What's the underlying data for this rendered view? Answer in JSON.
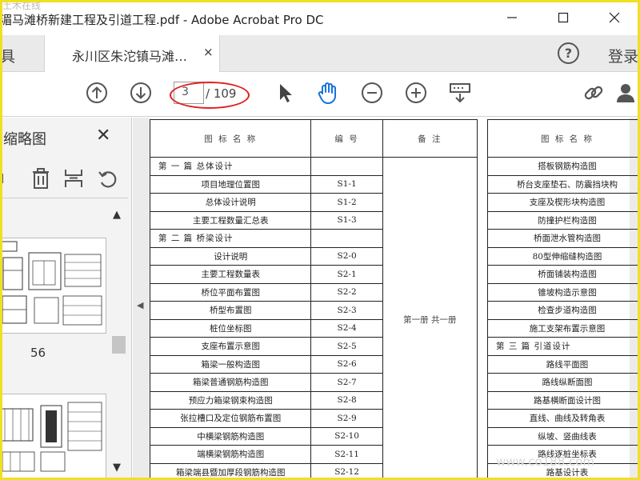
{
  "window": {
    "title": "滩桥新建工程及引道工程.pdf - Adobe Acrobat Pro DC",
    "title_prefix": "湄马",
    "watermark_top": "土木在线",
    "controls": [
      "—",
      "☐",
      "✕"
    ]
  },
  "tabs": {
    "tools_label": "具",
    "doc_label": "永川区朱沱镇马滩…",
    "close": "×",
    "help": "?",
    "login": "登录"
  },
  "toolbar": {
    "page_current": "3",
    "page_total": "/ 109"
  },
  "left_panel": {
    "title": "缩略图",
    "close": "✕",
    "thumb_page_number": "56",
    "scroll_up": "▲",
    "scroll_down": "▼"
  },
  "doc": {
    "collapse": "◀",
    "left_table": {
      "headers": [
        "图  标  名  称",
        "编    号",
        "备    注"
      ],
      "remark": "第一册  共一册",
      "rows": [
        {
          "name": "第  一  篇    总体设计",
          "code": "",
          "section": true
        },
        {
          "name": "项目地理位置图",
          "code": "S1-1"
        },
        {
          "name": "总体设计说明",
          "code": "S1-2"
        },
        {
          "name": "主要工程数量汇总表",
          "code": "S1-3"
        },
        {
          "name": "第  二  篇    桥梁设计",
          "code": "",
          "section": true
        },
        {
          "name": "设计说明",
          "code": "S2-0"
        },
        {
          "name": "主要工程数量表",
          "code": "S2-1"
        },
        {
          "name": "桥位平面布置图",
          "code": "S2-2"
        },
        {
          "name": "桥型布置图",
          "code": "S2-3"
        },
        {
          "name": "桩位坐标图",
          "code": "S2-4"
        },
        {
          "name": "支座布置示意图",
          "code": "S2-5"
        },
        {
          "name": "箱梁一般构造图",
          "code": "S2-6"
        },
        {
          "name": "箱梁普通钢筋构造图",
          "code": "S2-7"
        },
        {
          "name": "预应力箱梁钢束构造图",
          "code": "S2-8"
        },
        {
          "name": "张拉槽口及定位钢筋布置图",
          "code": "S2-9"
        },
        {
          "name": "中横梁钢筋构造图",
          "code": "S2-10"
        },
        {
          "name": "端横梁钢筋构造图",
          "code": "S2-11"
        },
        {
          "name": "箱梁端县暨加厚段钢筋构造图",
          "code": "S2-12"
        }
      ]
    },
    "right_table": {
      "header": "图  标  名  称",
      "rows": [
        "搭板钢筋构造图",
        "桥台支座垫石、防震挡块构",
        "支座及楔形块构造图",
        "防撞护栏构造图",
        "桥面泄水管构造图",
        "80型伸缩缝构造图",
        "桥面铺装构造图",
        "锥坡构造示意图",
        "检查步道构造图",
        "施工支架布置示意图",
        "第  三  篇    引道设计",
        "路线平面图",
        "路线纵断面图",
        "路基横断面设计图",
        "直线、曲线及转角表",
        "纵坡、竖曲线表",
        "路线逐桩坐标表",
        "路基设计表"
      ]
    }
  },
  "watermark": "www.co188.com",
  "colors": {
    "frame": "#f0e020",
    "annotation_oval": "#e02020",
    "tab_bar": "#eaeaea"
  }
}
